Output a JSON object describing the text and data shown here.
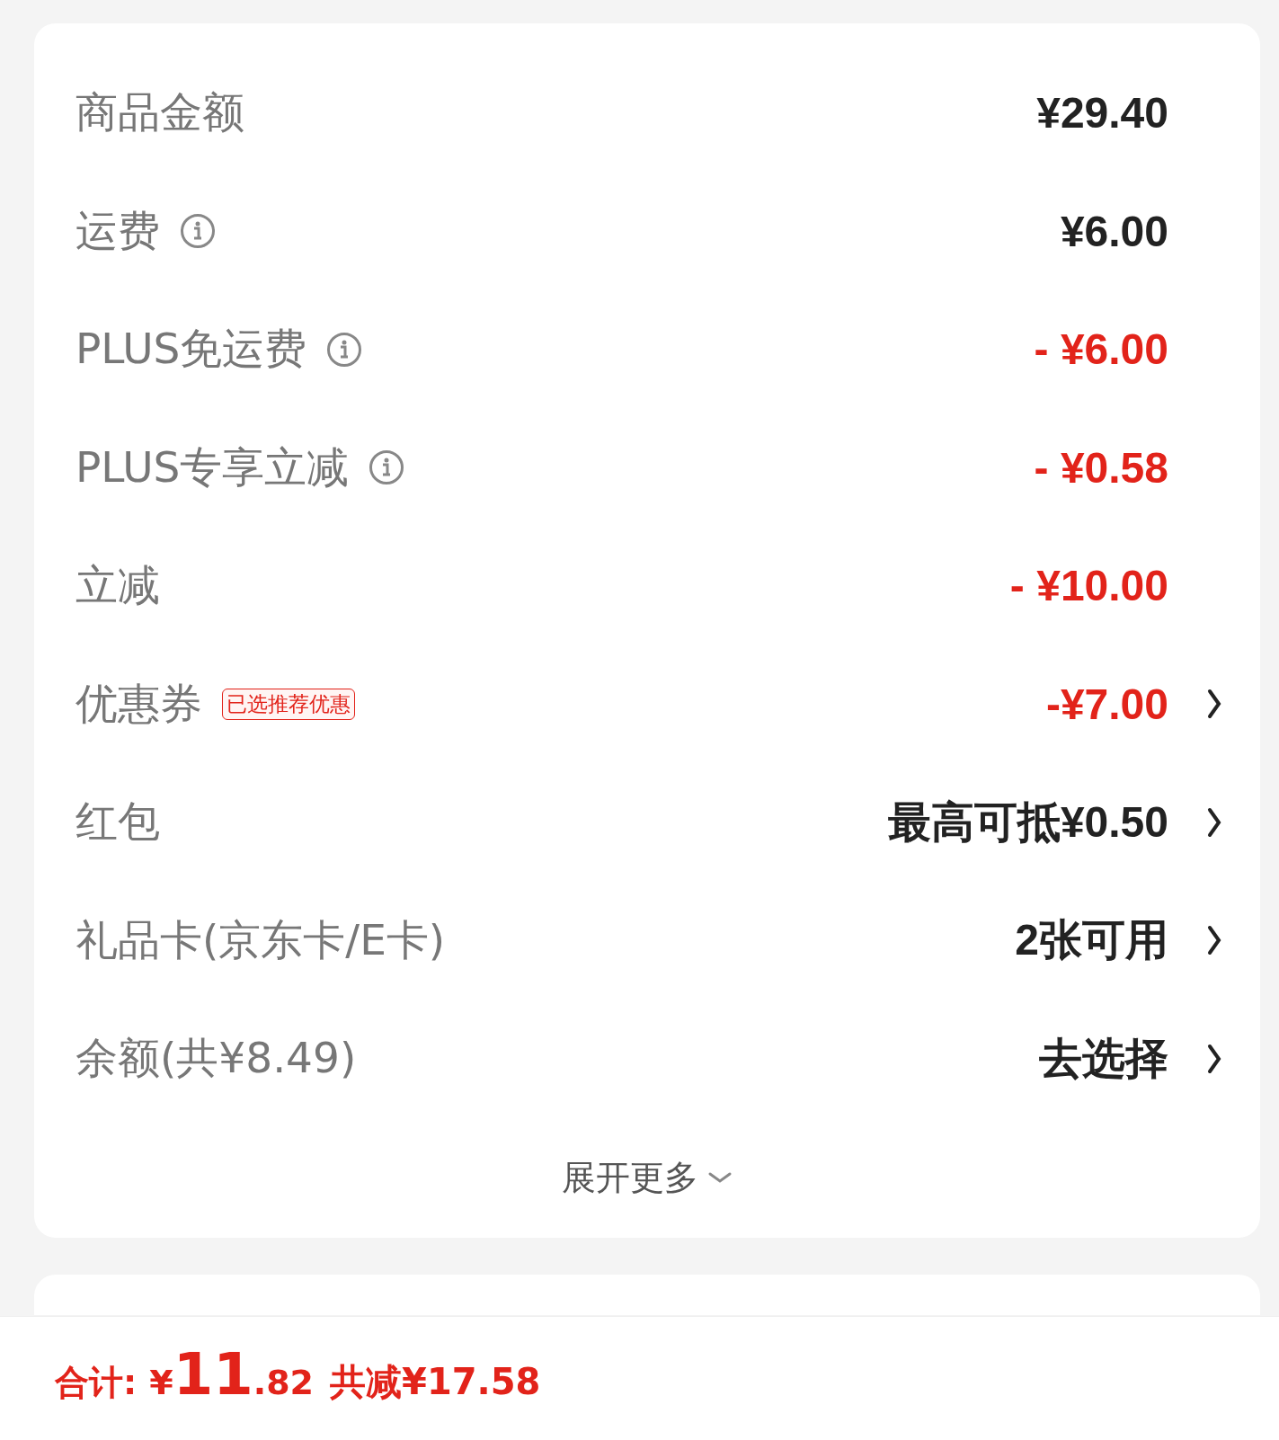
{
  "fee_rows": [
    {
      "label": "商品金额",
      "info": false,
      "value": "¥29.40",
      "kind": "normal",
      "arrow": false
    },
    {
      "label": "运费",
      "info": true,
      "value": "¥6.00",
      "kind": "normal",
      "arrow": false
    },
    {
      "label": "PLUS免运费",
      "info": true,
      "value": "- ¥6.00",
      "kind": "discount",
      "arrow": false
    },
    {
      "label": "PLUS专享立减",
      "info": true,
      "value": "- ¥0.58",
      "kind": "discount",
      "arrow": false
    },
    {
      "label": "立减",
      "info": false,
      "value": "- ¥10.00",
      "kind": "discount",
      "arrow": false
    },
    {
      "label": "优惠券",
      "info": false,
      "tag": "已选推荐优惠",
      "value": "-¥7.00",
      "kind": "discount",
      "arrow": true
    },
    {
      "label": "红包",
      "info": false,
      "value": "最高可抵¥0.50",
      "kind": "normal",
      "arrow": true
    },
    {
      "label": "礼品卡(京东卡/E卡)",
      "info": false,
      "value": "2张可用",
      "kind": "normal",
      "arrow": true
    },
    {
      "label": "余额(共¥8.49)",
      "info": false,
      "value": "去选择",
      "kind": "normal",
      "arrow": true
    }
  ],
  "expand": {
    "label": "展开更多"
  },
  "total": {
    "label": "合计:",
    "currency": "¥",
    "integer": "11",
    "decimal": ".82",
    "saved": "共减¥17.58"
  }
}
